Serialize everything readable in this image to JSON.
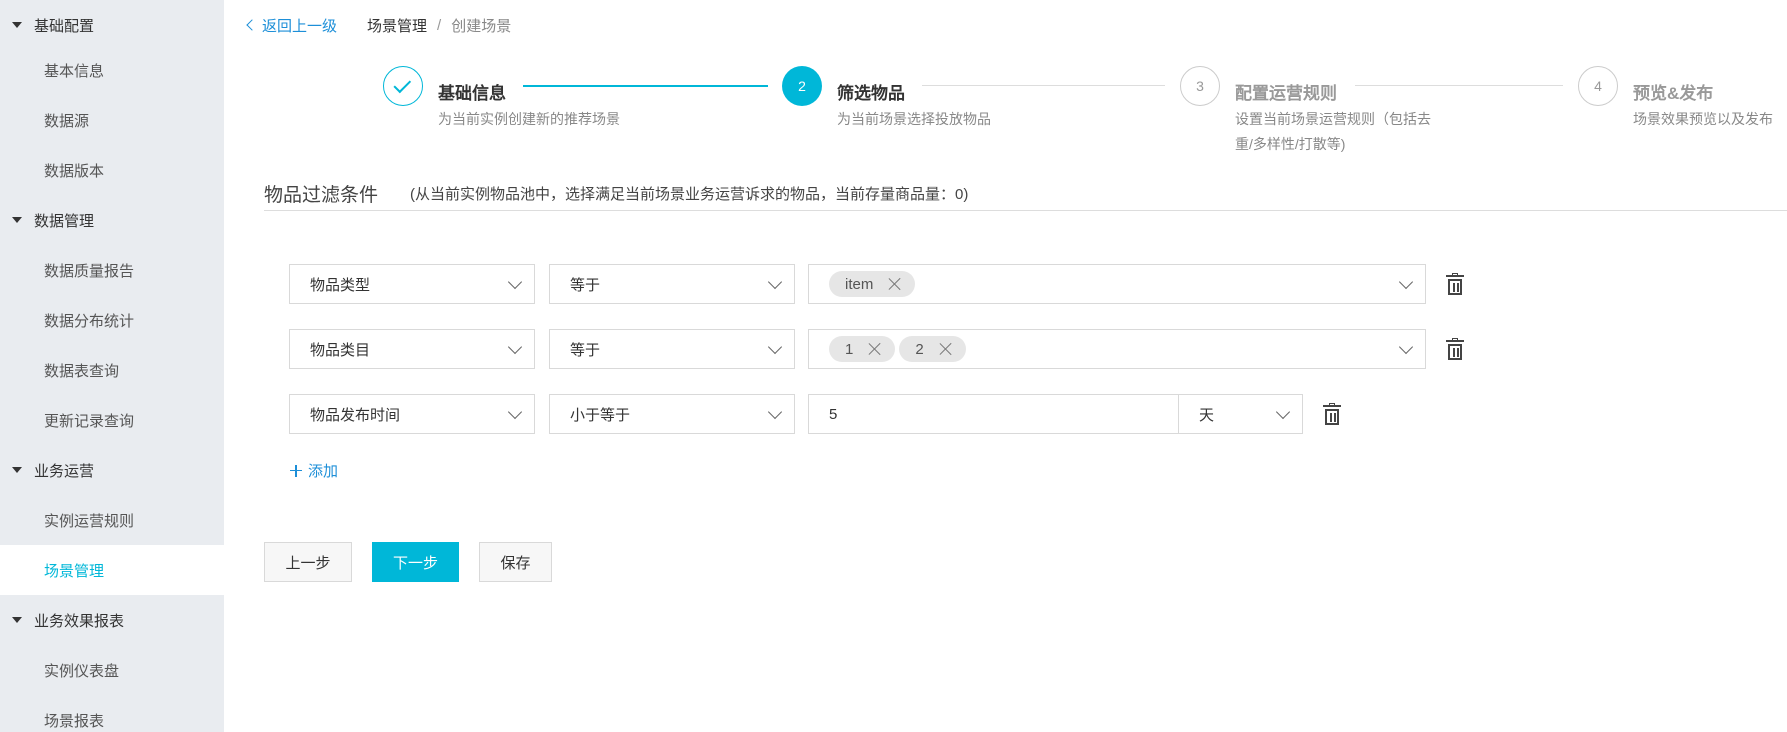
{
  "sidebar": {
    "groups": [
      {
        "label": "基础配置",
        "items": [
          "基本信息",
          "数据源",
          "数据版本"
        ]
      },
      {
        "label": "数据管理",
        "items": [
          "数据质量报告",
          "数据分布统计",
          "数据表查询",
          "更新记录查询"
        ]
      },
      {
        "label": "业务运营",
        "items": [
          "实例运营规则",
          "场景管理"
        ]
      },
      {
        "label": "业务效果报表",
        "items": [
          "实例仪表盘",
          "场景报表"
        ]
      }
    ],
    "active_item": "场景管理"
  },
  "breadcrumb": {
    "back_label": "返回上一级",
    "parent": "场景管理",
    "separator": "/",
    "current": "创建场景"
  },
  "steps": [
    {
      "number": "1",
      "status": "done",
      "title": "基础信息",
      "desc": "为当前实例创建新的推荐场景"
    },
    {
      "number": "2",
      "status": "current",
      "title": "筛选物品",
      "desc": "为当前场景选择投放物品"
    },
    {
      "number": "3",
      "status": "todo",
      "title": "配置运营规则",
      "desc_line1": "设置当前场景运营规则（包括去",
      "desc_line2": "重/多样性/打散等)"
    },
    {
      "number": "4",
      "status": "todo",
      "title": "预览&发布",
      "desc": "场景效果预览以及发布"
    }
  ],
  "section": {
    "title": "物品过滤条件",
    "note": "(从当前实例物品池中，选择满足当前场景业务运营诉求的物品，当前存量商品量：0)"
  },
  "filters": [
    {
      "field": "物品类型",
      "operator": "等于",
      "tags": [
        "item"
      ]
    },
    {
      "field": "物品类目",
      "operator": "等于",
      "tags": [
        "1",
        "2"
      ]
    },
    {
      "field": "物品发布时间",
      "operator": "小于等于",
      "value": "5",
      "unit": "天"
    }
  ],
  "add_label": "添加",
  "buttons": {
    "prev": "上一步",
    "next": "下一步",
    "save": "保存"
  },
  "colors": {
    "accent": "#00b7d8",
    "link": "#1d8fd8",
    "sidebar_bg": "#e9ecf0"
  }
}
